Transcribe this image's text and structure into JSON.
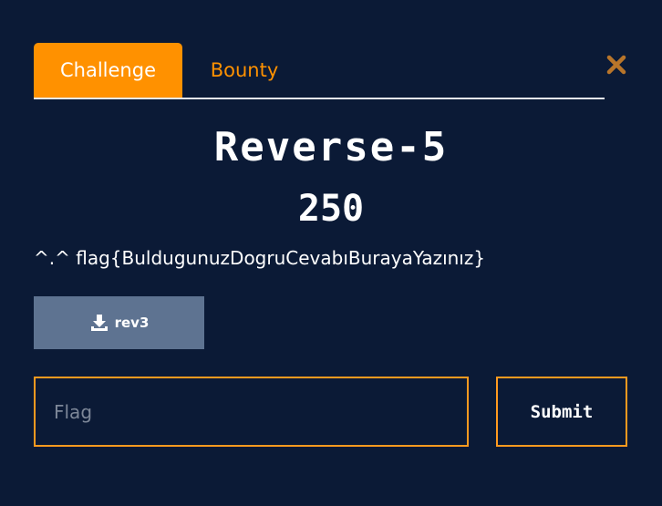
{
  "tabs": [
    {
      "label": "Challenge",
      "active": true
    },
    {
      "label": "Bounty",
      "active": false
    }
  ],
  "challenge": {
    "name": "Reverse-5",
    "points": "250",
    "description": "^.^ flag{BuldugunuzDogruCevabıBurayaYazınız}"
  },
  "file": {
    "label": "rev3",
    "icon": "download-icon"
  },
  "flag_input": {
    "placeholder": "Flag",
    "value": ""
  },
  "submit_label": "Submit",
  "close_icon": "close-icon",
  "colors": {
    "background": "#0b1a36",
    "accent": "#ff9100",
    "file_button": "#5e7391",
    "input_border": "#ff9a1f",
    "close": "#b8752a"
  }
}
